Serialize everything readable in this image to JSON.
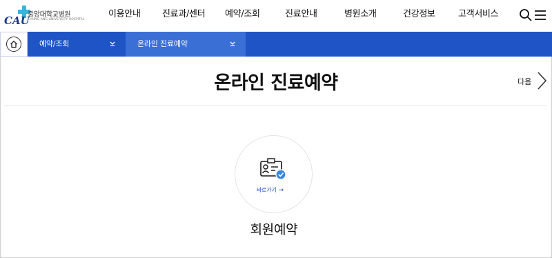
{
  "logo": {
    "hospital_name": "중앙대학교병원",
    "sub_name": "CHUNG-ANG UNIVERSITY HOSPITAL",
    "mark_text": "CAU"
  },
  "nav": {
    "items": [
      {
        "label": "이용안내"
      },
      {
        "label": "진료과/센터"
      },
      {
        "label": "예약/조회"
      },
      {
        "label": "진료안내"
      },
      {
        "label": "병원소개"
      },
      {
        "label": "건강정보"
      },
      {
        "label": "고객서비스"
      }
    ],
    "search_icon": "search-icon",
    "menu_icon": "hamburger-menu-icon"
  },
  "breadcrumb": {
    "home_icon": "home-icon",
    "level1": "예약/조회",
    "level2": "온라인 진료예약"
  },
  "page": {
    "title": "온라인 진료예약",
    "next_label": "다음"
  },
  "member_reservation": {
    "icon": "id-card-check-icon",
    "shortcut_label": "바로가기",
    "arrow": "→",
    "title": "회원예약"
  },
  "colors": {
    "primary_blue": "#1e54c5",
    "secondary_blue": "#3a6fd6",
    "logo_cyan": "#36b6d6"
  }
}
